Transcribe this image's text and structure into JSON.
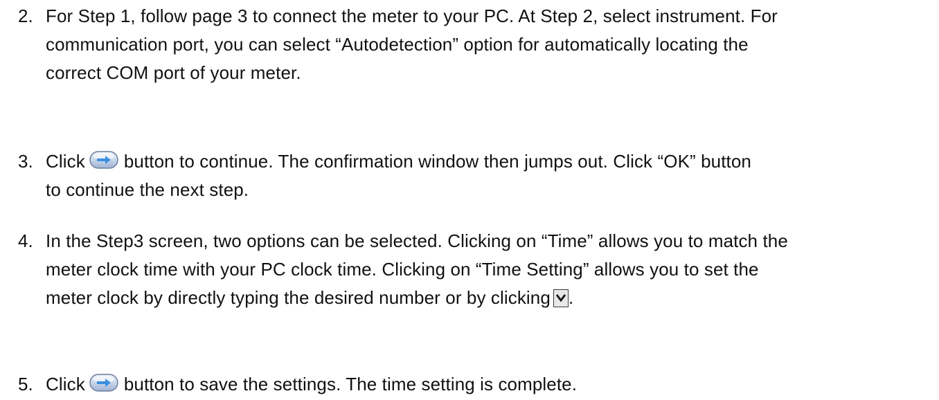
{
  "steps": [
    {
      "number": "2.",
      "lines": [
        "For Step 1, follow page 3 to connect the meter to your PC. At Step 2, select instrument. For",
        "communication port, you can select “Autodetection” option for automatically locating the",
        "correct COM port of your meter."
      ]
    },
    {
      "number": "3.",
      "line1_before_icon": "Click",
      "line1_after_icon": "button to continue. The confirmation window then jumps out. Click “OK” button",
      "line2": "to continue the next step.",
      "icon": "next-arrow-button-icon"
    },
    {
      "number": "4.",
      "lines": [
        "In the Step3 screen, two options can be selected. Clicking on “Time” allows you to match the",
        "meter clock time with your PC clock time. Clicking on “Time Setting” allows you to set the"
      ],
      "line3_before_icon": "meter clock by directly typing the desired number or by clicking",
      "line3_after_icon": ".",
      "icon": "dropdown-arrow-icon"
    },
    {
      "number": "5.",
      "line1_before_icon": "Click",
      "line1_after_icon": "button to save the settings. The time setting is complete.",
      "icon": "next-arrow-button-icon"
    }
  ],
  "colors": {
    "text": "#111111",
    "button_fill": "#c9d6ea",
    "arrow": "#3d8fe0"
  }
}
